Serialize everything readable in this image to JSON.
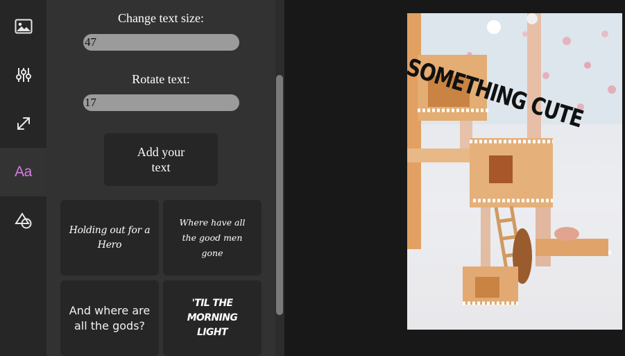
{
  "sidebar": {
    "items": [
      {
        "icon": "image-icon"
      },
      {
        "icon": "sliders-icon"
      },
      {
        "icon": "resize-icon"
      },
      {
        "icon": "text-icon",
        "label": "Aa",
        "active": true
      },
      {
        "icon": "shapes-icon"
      }
    ]
  },
  "panel": {
    "text_size_label": "Change text size:",
    "text_size_value": "47",
    "rotate_label": "Rotate text:",
    "rotate_value": "17",
    "add_text_button": "Add your text",
    "presets": [
      "Holding out for a Hero",
      "Where have all the good men gone",
      "And where are all the gods?",
      "'TIL THE MORNING LIGHT"
    ]
  },
  "canvas": {
    "overlay_text": "SOMETHING CUTE"
  },
  "colors": {
    "accent": "#d77be6",
    "panel_bg": "#323232",
    "rail_bg": "#262626",
    "field_bg": "#9b9b9b"
  }
}
